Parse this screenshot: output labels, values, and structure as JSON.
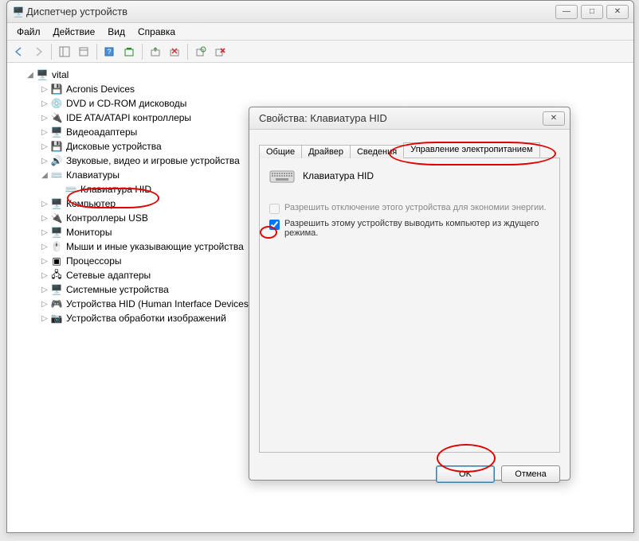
{
  "mainWindow": {
    "title": "Диспетчер устройств",
    "menu": {
      "file": "Файл",
      "action": "Действие",
      "view": "Вид",
      "help": "Справка"
    },
    "tree": {
      "root": "vital",
      "items": [
        "Acronis Devices",
        "DVD и CD-ROM дисководы",
        "IDE ATA/ATAPI контроллеры",
        "Видеоадаптеры",
        "Дисковые устройства",
        "Звуковые, видео и игровые устройства"
      ],
      "keyboards": {
        "label": "Клавиатуры",
        "child": "Клавиатура HID"
      },
      "itemsAfter": [
        "Компьютер",
        "Контроллеры USB",
        "Мониторы",
        "Мыши и иные указывающие устройства",
        "Процессоры",
        "Сетевые адаптеры",
        "Системные устройства",
        "Устройства HID (Human Interface Devices)",
        "Устройства обработки изображений"
      ]
    }
  },
  "dialog": {
    "title": "Свойства: Клавиатура HID",
    "tabs": {
      "general": "Общие",
      "driver": "Драйвер",
      "details": "Сведения",
      "power": "Управление электропитанием"
    },
    "deviceName": "Клавиатура HID",
    "check1": "Разрешить отключение этого устройства для экономии энергии.",
    "check2": "Разрешить этому устройству выводить компьютер из ждущего режима.",
    "buttons": {
      "ok": "OK",
      "cancel": "Отмена"
    }
  }
}
